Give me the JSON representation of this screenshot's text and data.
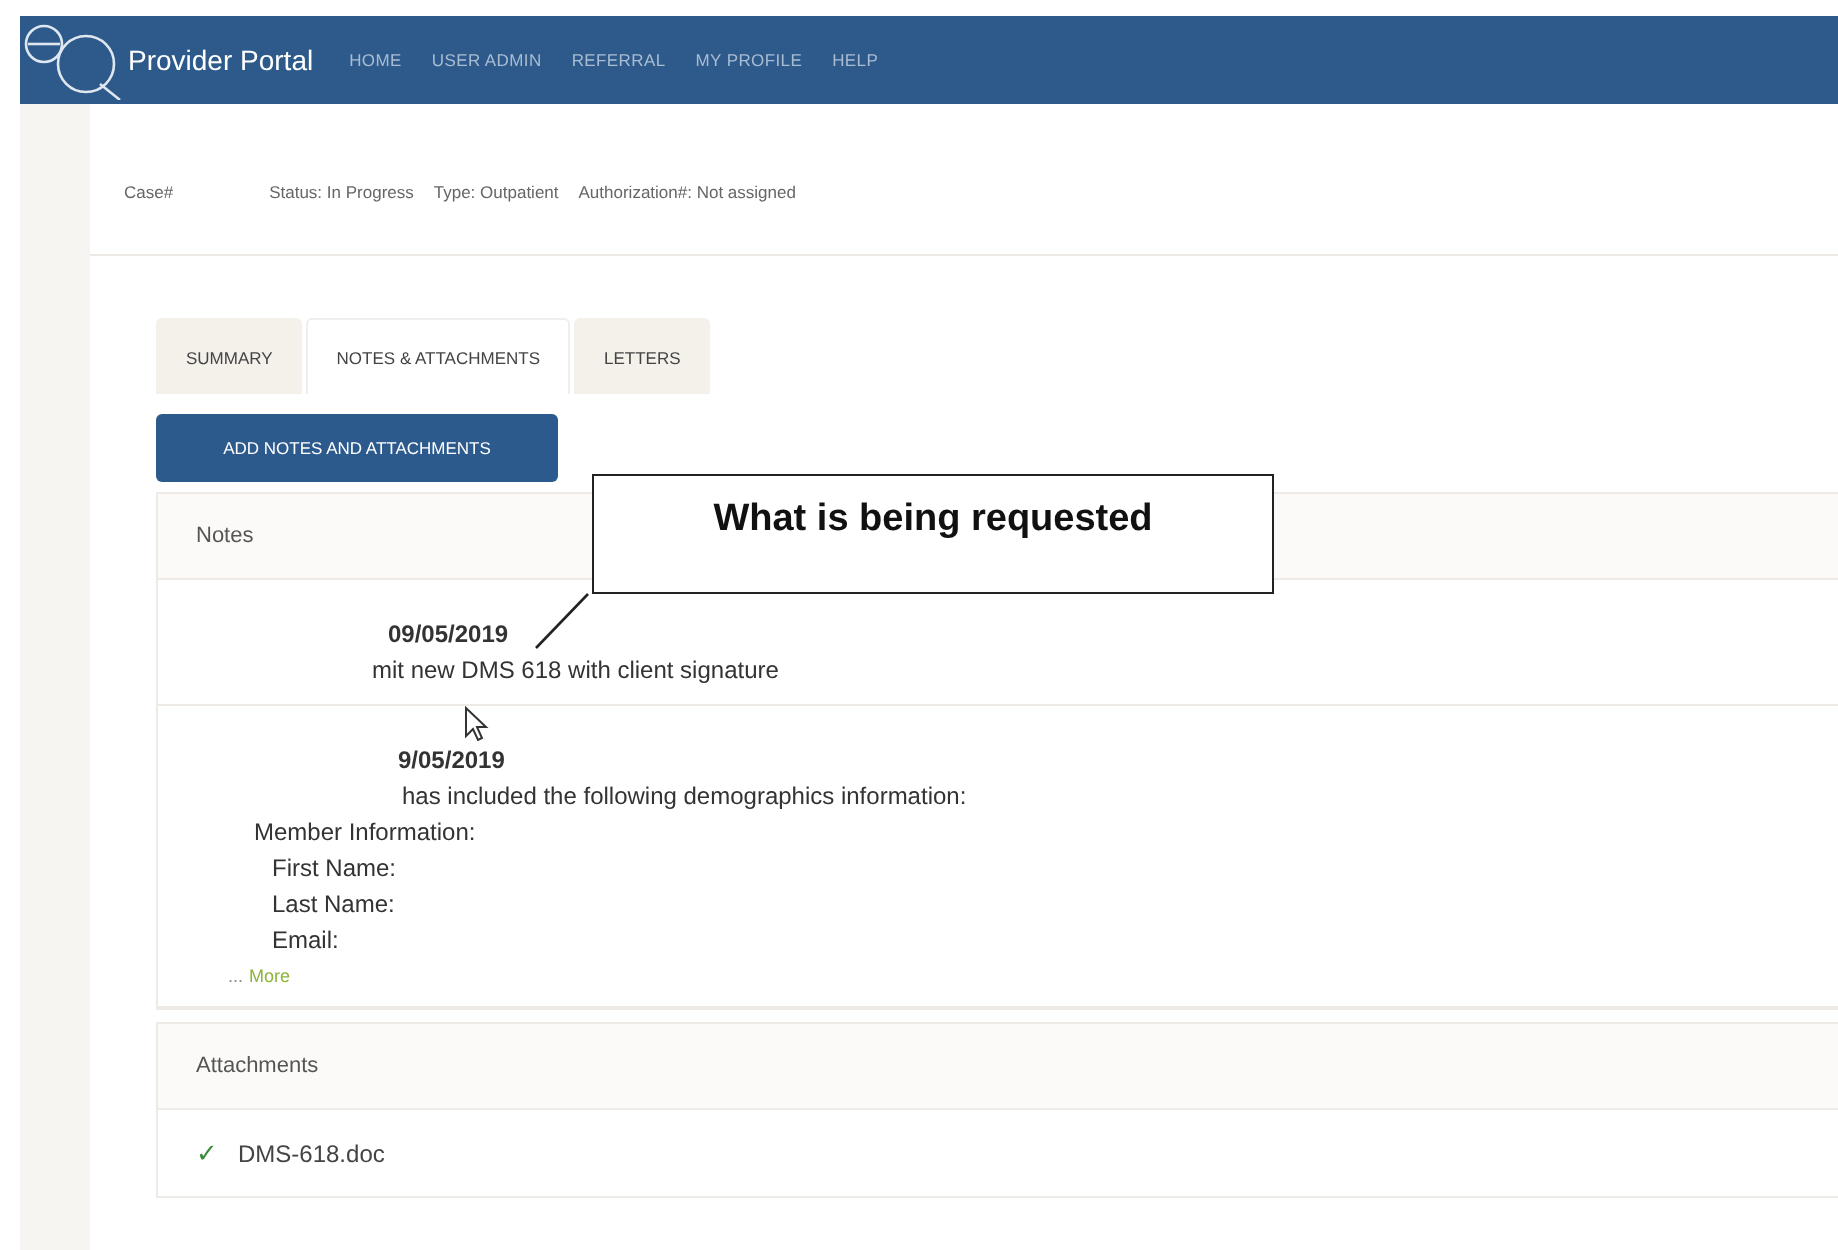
{
  "header": {
    "brand": "Provider Portal",
    "nav": [
      {
        "label": "HOME"
      },
      {
        "label": "USER ADMIN"
      },
      {
        "label": "REFERRAL"
      },
      {
        "label": "MY PROFILE"
      },
      {
        "label": "HELP"
      }
    ]
  },
  "case_bar": {
    "fields": [
      {
        "label": "Case#"
      },
      {
        "label": "Status:",
        "value": "In Progress"
      },
      {
        "label": "Type:",
        "value": "Outpatient"
      },
      {
        "label": "Authorization#:",
        "value": "Not assigned"
      }
    ]
  },
  "tabs": [
    {
      "label": "SUMMARY",
      "selected": false
    },
    {
      "label": "NOTES & ATTACHMENTS",
      "selected": true
    },
    {
      "label": "LETTERS",
      "selected": false
    }
  ],
  "add_button": "ADD NOTES AND ATTACHMENTS",
  "notes": {
    "title": "Notes",
    "items": [
      {
        "date": "09/05/2019",
        "lines": [
          {
            "text": "mit new DMS 618 with client signature"
          }
        ]
      },
      {
        "date": "9/05/2019",
        "lines": [
          {
            "text": "has included the following demographics information:"
          },
          {
            "text": "Member Information:",
            "children": [
              {
                "text": "First Name:"
              },
              {
                "text": "Last Name:"
              },
              {
                "text": "Email:"
              }
            ]
          }
        ],
        "more_prefix": "...",
        "more": "More"
      }
    ]
  },
  "attachments": {
    "title": "Attachments",
    "items": [
      {
        "name": "DMS-618.doc",
        "mark": "✓"
      }
    ]
  },
  "callout": "What is being requested"
}
